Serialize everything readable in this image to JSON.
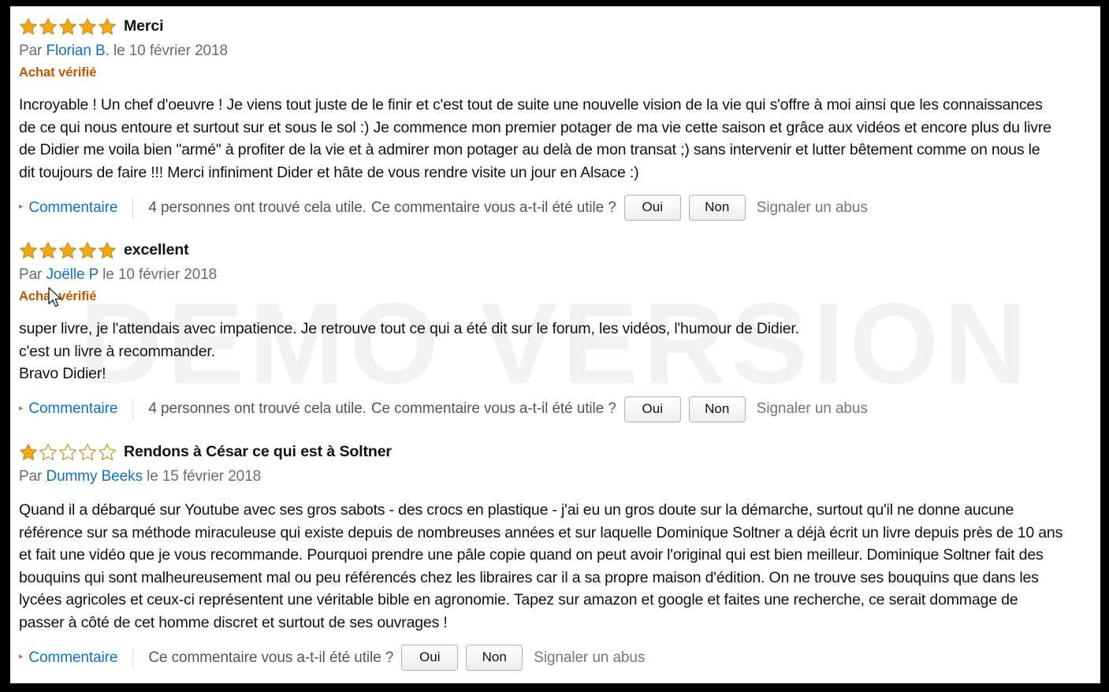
{
  "watermark": {
    "text": "DEMO VERSION"
  },
  "colors": {
    "star_fill": "#f2a819",
    "star_stroke": "#c7891a",
    "link": "#0d72c4",
    "verified": "#c45500",
    "body_text": "#111111",
    "muted_text": "#6b6b6b",
    "page_border": "#000000",
    "sheet_background": "#ffffff",
    "watermark": "#f2f2f2"
  },
  "labels": {
    "by": "Par",
    "verified_purchase": "Achat vérifié",
    "comment": "Commentaire",
    "helpful_question": "Ce commentaire vous a-t-il été utile ?",
    "yes": "Oui",
    "no": "Non",
    "report_abuse": "Signaler un abus",
    "caret": "▸"
  },
  "reviews": [
    {
      "rating": 5,
      "rating_label": "5 sur 5 étoiles",
      "title": "Merci",
      "author": "Florian B.",
      "date": "le 10 février 2018",
      "verified": "Achat vérifié",
      "body_lines": [
        "Incroyable ! Un chef d'oeuvre ! Je viens tout juste de le finir et c'est tout de suite une nouvelle vision de la vie qui s'offre à moi ainsi que les connaissances",
        "de ce qui nous entoure et surtout sur et sous le sol :) Je commence mon premier potager de ma vie cette saison et grâce aux vidéos et encore plus du livre",
        "de Didier me voila bien \"armé\" à profiter de la vie et à admirer mon potager au delà de mon transat ;) sans intervenir et lutter bêtement comme on nous le",
        "dit toujours de faire !!! Merci infiniment Dider et hâte de vous rendre visite un jour en Alsace :)"
      ],
      "helpful_count_text": "4 personnes ont trouvé cela utile.",
      "helpful_question": "Ce commentaire vous a-t-il été utile ?"
    },
    {
      "rating": 5,
      "rating_label": "5 sur 5 étoiles",
      "title": "excellent",
      "author": "Joëlle P",
      "date": "le 10 février 2018",
      "verified": "Achat vérifié",
      "body_lines": [
        "super livre, je l'attendais avec impatience. Je retrouve tout ce qui a été dit sur le forum, les vidéos, l'humour de Didier.",
        "c'est un livre à recommander.",
        "Bravo Didier!"
      ],
      "helpful_count_text": "4 personnes ont trouvé cela utile.",
      "helpful_question": "Ce commentaire vous a-t-il été utile ?"
    },
    {
      "rating": 1,
      "rating_label": "1 sur 5 étoiles",
      "title": "Rendons à César ce qui est à Soltner",
      "author": "Dummy Beeks",
      "date": "le 15 février 2018",
      "verified": "",
      "body_lines": [
        "Quand il a débarqué sur Youtube avec ses gros sabots - des crocs en plastique - j'ai eu un gros doute sur la démarche, surtout qu'il ne donne aucune",
        "référence sur sa méthode miraculeuse qui existe depuis de nombreuses années et sur laquelle Dominique Soltner a déjà écrit un livre depuis près de 10 ans",
        "et fait une vidéo que je vous recommande. Pourquoi prendre une pâle copie quand on peut avoir l'original qui est bien meilleur. Dominique Soltner fait des",
        "bouquins qui sont malheureusement mal ou peu référencés chez les libraires car il a sa propre maison d'édition. On ne trouve ses bouquins que dans les",
        "lycées agricoles et ceux-ci représentent une véritable bible en agronomie. Tapez sur amazon et google et faites une recherche, ce serait dommage de",
        "passer à côté de cet homme discret et surtout de ses ouvrages !"
      ],
      "helpful_count_text": "",
      "helpful_question": "Ce commentaire vous a-t-il été utile ?"
    }
  ]
}
